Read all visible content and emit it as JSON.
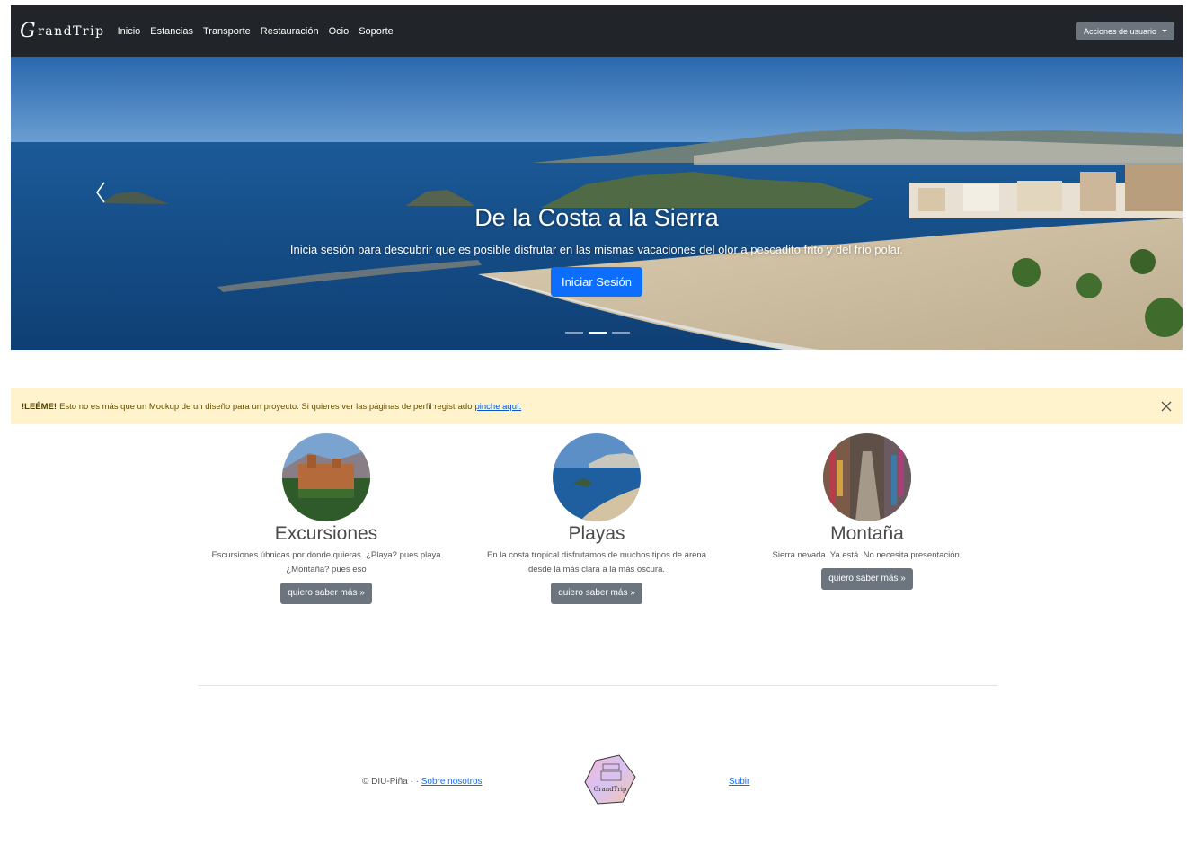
{
  "navbar": {
    "brand_initial": "G",
    "brand_rest": "randTrip",
    "links": [
      "Inicio",
      "Estancias",
      "Transporte",
      "Restauración",
      "Ocio",
      "Soporte"
    ],
    "user_actions_label": "Acciones de usuario"
  },
  "hero": {
    "title": "De la Costa a la Sierra",
    "subtitle": "Inicia sesión para descubrir que es posible disfrutar en las mismas vacaciones del olor a pescadito frito y del frío polar.",
    "button_label": "Iniciar Sesión",
    "slide_count": 3,
    "active_slide": 2
  },
  "alert": {
    "strong": "!LEÉME!",
    "text": "Esto no es más que un Mockup de un diseño para un proyecto. Si quieres ver las páginas de perfil registrado",
    "link": "pinche aquí."
  },
  "features": [
    {
      "title": "Excursiones",
      "text": "Escursiones úbnicas por donde quieras. ¿Playa? pues playa ¿Montaña? pues eso",
      "button": "quiero saber más »"
    },
    {
      "title": "Playas",
      "text": "En la costa tropical disfrutamos de muchos tipos de arena desde la más clara a la más oscura.",
      "button": "quiero saber más »"
    },
    {
      "title": "Montaña",
      "text": "Sierra nevada. Ya está. No necesita presentación.",
      "button": "quiero saber más »"
    }
  ],
  "footer": {
    "copyright": "© DIU-Piña · · ",
    "about_link": "Sobre nosotros",
    "up_link": "Subir",
    "logo_text": "GrandTrip"
  },
  "colors": {
    "navbar_bg": "#212529",
    "primary": "#0d6efd",
    "secondary": "#6c757d",
    "alert_bg": "#fff3cd"
  }
}
